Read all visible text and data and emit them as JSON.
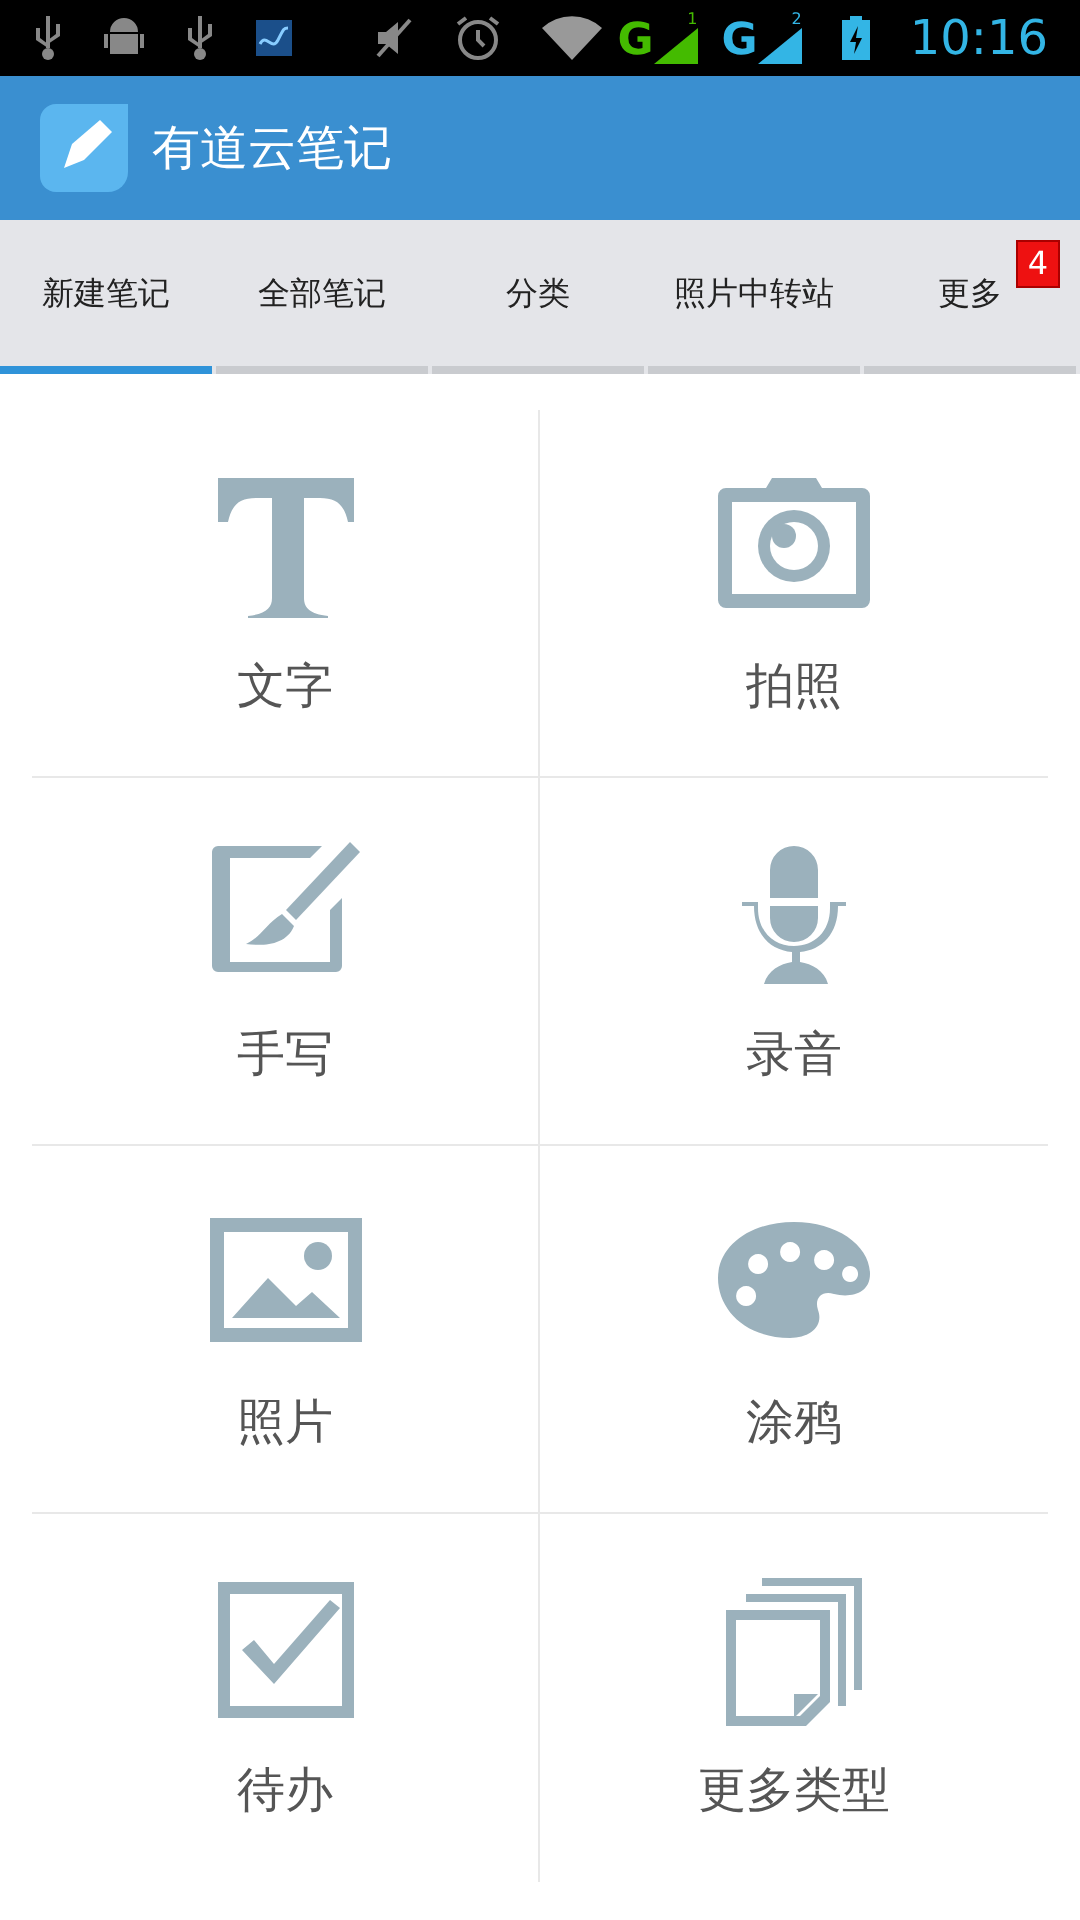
{
  "status_bar": {
    "time": "10:16",
    "networks": [
      {
        "label": "G",
        "sim": "1",
        "color": "#44bb00"
      },
      {
        "label": "G",
        "sim": "2",
        "color": "#33b5e5"
      }
    ]
  },
  "app_bar": {
    "title": "有道云笔记"
  },
  "tabs": [
    {
      "label": "新建笔记",
      "selected": true
    },
    {
      "label": "全部笔记",
      "selected": false
    },
    {
      "label": "分类",
      "selected": false
    },
    {
      "label": "照片中转站",
      "selected": false
    },
    {
      "label": "更多",
      "selected": false,
      "badge": "4"
    }
  ],
  "note_types": [
    {
      "label": "文字",
      "kind": "text"
    },
    {
      "label": "拍照",
      "kind": "camera"
    },
    {
      "label": "手写",
      "kind": "brush"
    },
    {
      "label": "录音",
      "kind": "mic"
    },
    {
      "label": "照片",
      "kind": "image"
    },
    {
      "label": "涂鸦",
      "kind": "palette"
    },
    {
      "label": "待办",
      "kind": "check"
    },
    {
      "label": "更多类型",
      "kind": "pages"
    }
  ]
}
